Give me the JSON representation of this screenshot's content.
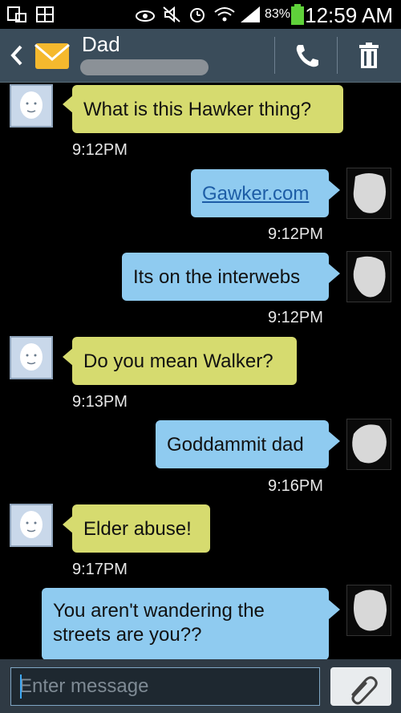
{
  "status_bar": {
    "battery": "83%",
    "time": "12:59 AM"
  },
  "header": {
    "contact_name": "Dad"
  },
  "messages": [
    {
      "text": "What is this Hawker thing?",
      "time": "9:12PM"
    },
    {
      "text": "Gawker.com",
      "time": "9:12PM"
    },
    {
      "text": "Its on the interwebs",
      "time": "9:12PM"
    },
    {
      "text": "Do you mean Walker?",
      "time": "9:13PM"
    },
    {
      "text": "Goddammit dad",
      "time": "9:16PM"
    },
    {
      "text": "Elder abuse!",
      "time": "9:17PM"
    },
    {
      "line1": "You aren't wandering the",
      "line2": "streets are you??"
    }
  ],
  "composer": {
    "placeholder": "Enter message"
  },
  "colors": {
    "received_bubble": "#d6db6f",
    "sent_bubble": "#8fcbf0",
    "header_bg": "#3a4c5a"
  }
}
